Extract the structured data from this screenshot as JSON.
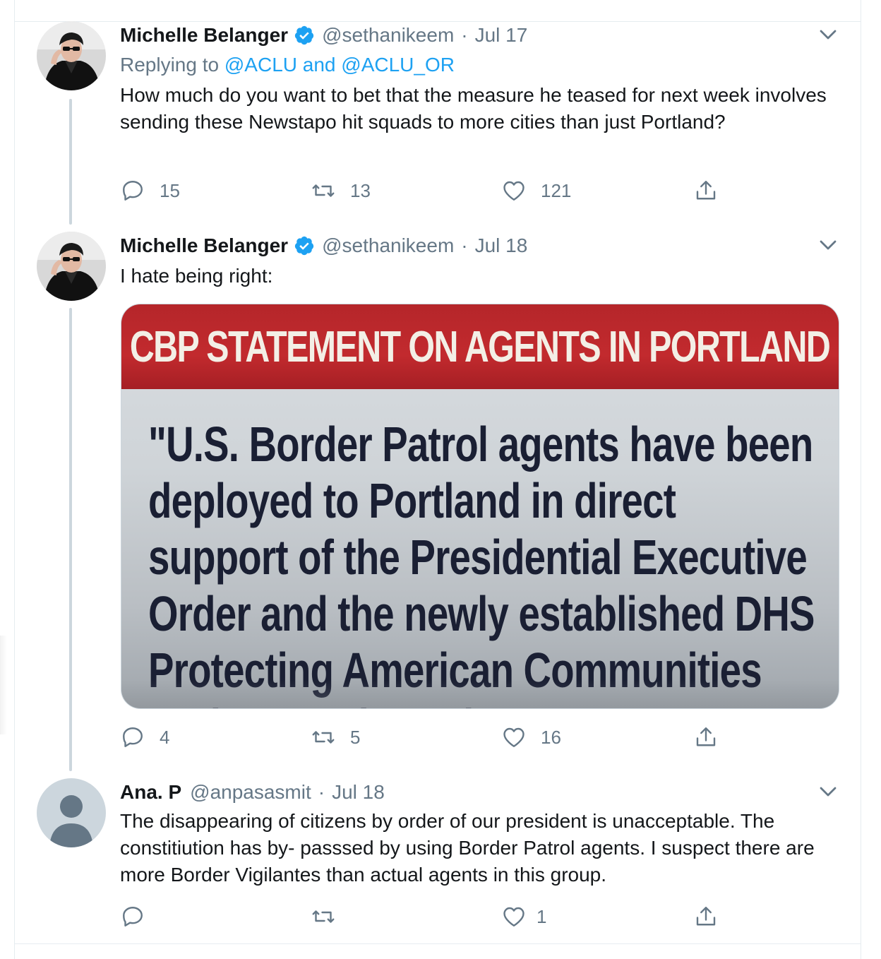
{
  "tweets": [
    {
      "name": "Michelle Belanger",
      "verified": true,
      "handle": "@sethanikeem",
      "dot": "·",
      "date": "Jul 17",
      "replying_prefix": "Replying to ",
      "replying_user1": "@ACLU",
      "replying_and": " and ",
      "replying_user2": "@ACLU_OR",
      "text": "How much do you want to bet that the measure he teased for next week involves sending these Newstapo hit squads to more cities than just Portland?",
      "replies": "15",
      "retweets": "13",
      "likes": "121"
    },
    {
      "name": "Michelle Belanger",
      "verified": true,
      "handle": "@sethanikeem",
      "dot": "·",
      "date": "Jul 18",
      "text": "I hate being right:",
      "media": {
        "banner": "CBP STATEMENT ON AGENTS IN PORTLAND",
        "quote": "\"U.S. Border Patrol agents have been\ndeployed to Portland in direct\nsupport of the Presidential Executive\nOrder and the newly established DHS\nProtecting American Communities\nTask Force (PACT)"
      },
      "replies": "4",
      "retweets": "5",
      "likes": "16"
    },
    {
      "name": "Ana. P",
      "verified": false,
      "handle": "@anpasasmit",
      "dot": "·",
      "date": "Jul 18",
      "text": "The disappearing of citizens by order of our president is unacceptable. The constitiution has by- passsed by using Border Patrol agents. I suspect there are more Border Vigilantes than actual agents in this group.",
      "replies": "",
      "retweets": "",
      "likes": "1"
    }
  ],
  "icons": {
    "reply": "reply-icon",
    "retweet": "retweet-icon",
    "like": "heart-icon",
    "share": "share-icon",
    "caret": "chevron-down-icon",
    "verified": "verified-badge-icon"
  },
  "colors": {
    "text": "#14171a",
    "secondary": "#657786",
    "link": "#1da1f2",
    "border": "#e6ecf0",
    "thread_line": "#ccd6dd"
  }
}
